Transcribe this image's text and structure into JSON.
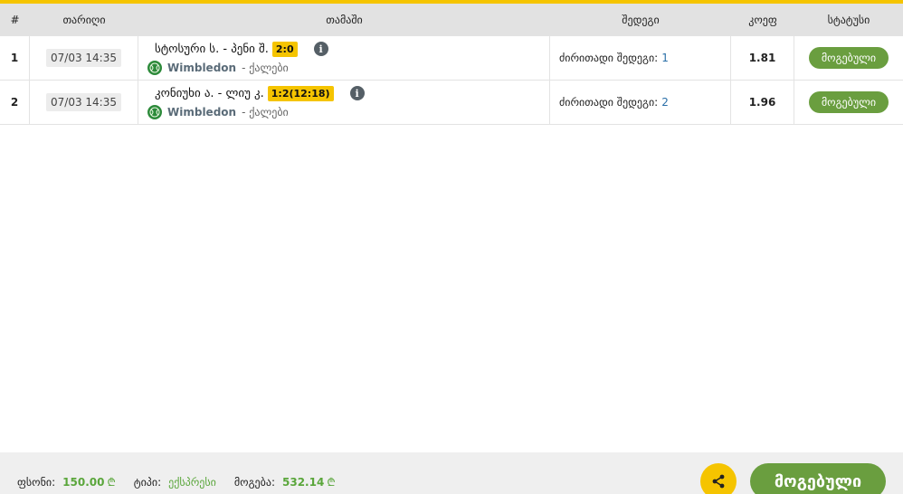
{
  "header": {
    "num": "#",
    "date": "თარიღი",
    "match": "თამაში",
    "results": "შედეგი",
    "coef": "კოეფ",
    "status": "სტატუსი"
  },
  "rows": [
    {
      "num": "1",
      "date": "07/03 14:35",
      "teams": "სტოსური ს. - პენი შ.",
      "score": "2:0",
      "league": "Wimbledon",
      "league_sub": "- ქალები",
      "results_label": "ძირითადი შედეგი:",
      "results_value": "1",
      "coef": "1.81",
      "status": "მოგებული"
    },
    {
      "num": "2",
      "date": "07/03 14:35",
      "teams": "კონიუხი ა. - ლიუ კ.",
      "score": "1:2(12:18)",
      "league": "Wimbledon",
      "league_sub": "- ქალები",
      "results_label": "ძირითადი შედეგი:",
      "results_value": "2",
      "coef": "1.96",
      "status": "მოგებული"
    }
  ],
  "footer": {
    "stake_label": "ფსონი:",
    "stake_value": "150.00",
    "type_label": "ტიპი:",
    "type_value": "ექსპრესი",
    "win_label": "მოგება:",
    "win_value": "532.14",
    "currency": "₾",
    "status": "მოგებული"
  },
  "icons": {
    "info": "info-icon",
    "league": "tennis-icon",
    "share": "share-icon"
  },
  "colors": {
    "accent": "#f5c400",
    "success": "#6a9e3f",
    "link": "#2a6fa8"
  }
}
